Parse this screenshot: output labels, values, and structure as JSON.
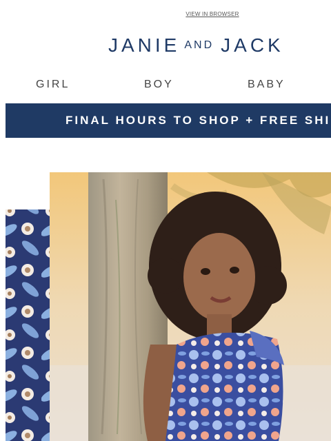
{
  "header": {
    "view_in_browser": "VIEW IN BROWSER",
    "logo_left": "JANIE",
    "logo_mid": "AND",
    "logo_right": "JACK"
  },
  "nav": {
    "items": [
      {
        "label": "GIRL"
      },
      {
        "label": "BOY"
      },
      {
        "label": "BABY"
      }
    ]
  },
  "banner": {
    "text": "FINAL HOURS TO SHOP + FREE SHIPP"
  },
  "colors": {
    "brand_navy": "#1f3a64",
    "floral_navy": "#2b3a73",
    "floral_blue": "#8bb0e0"
  }
}
